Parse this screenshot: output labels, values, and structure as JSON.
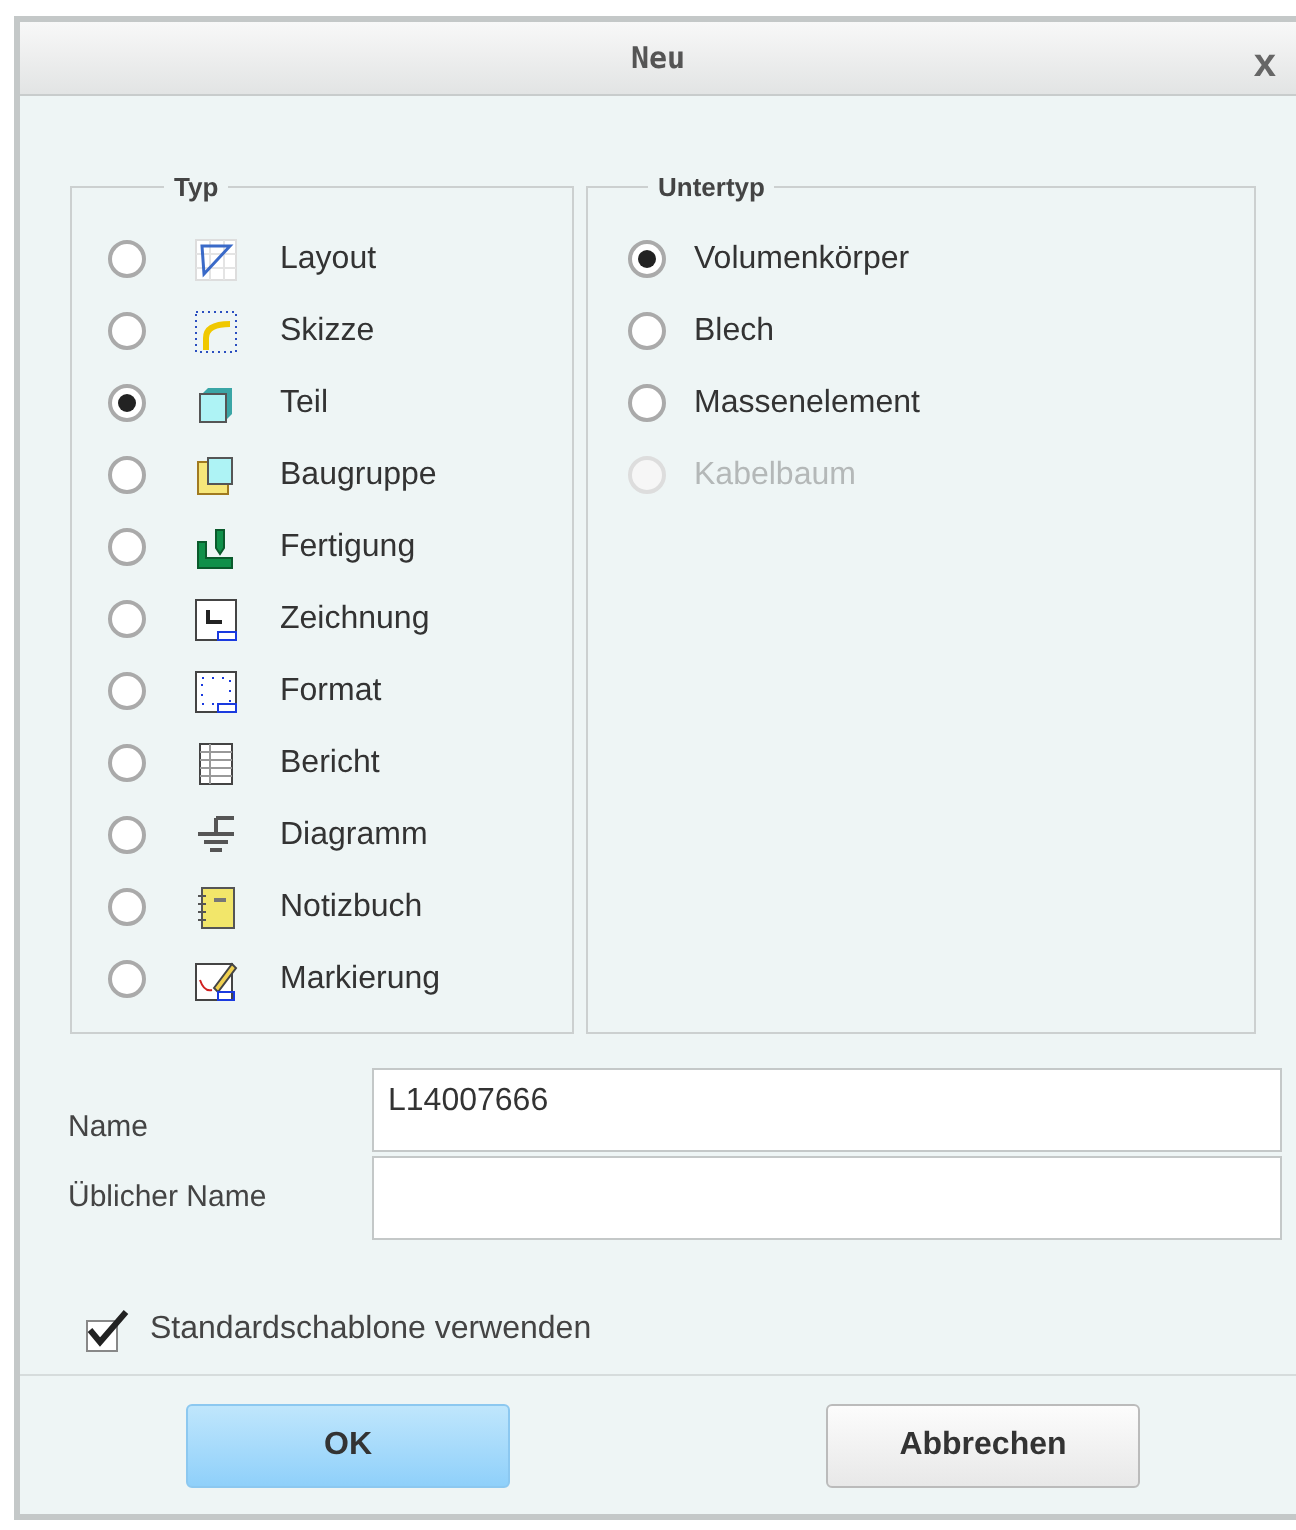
{
  "window": {
    "title": "Neu",
    "close": "x"
  },
  "typ": {
    "title": "Typ",
    "items": [
      {
        "label": "Layout",
        "kind": "layout",
        "selected": false
      },
      {
        "label": "Skizze",
        "kind": "sketch",
        "selected": false
      },
      {
        "label": "Teil",
        "kind": "part",
        "selected": true
      },
      {
        "label": "Baugruppe",
        "kind": "assembly",
        "selected": false
      },
      {
        "label": "Fertigung",
        "kind": "manufacturing",
        "selected": false
      },
      {
        "label": "Zeichnung",
        "kind": "drawing",
        "selected": false
      },
      {
        "label": "Format",
        "kind": "format",
        "selected": false
      },
      {
        "label": "Bericht",
        "kind": "report",
        "selected": false
      },
      {
        "label": "Diagramm",
        "kind": "diagram",
        "selected": false
      },
      {
        "label": "Notizbuch",
        "kind": "notebook",
        "selected": false
      },
      {
        "label": "Markierung",
        "kind": "markup",
        "selected": false
      }
    ]
  },
  "untertyp": {
    "title": "Untertyp",
    "items": [
      {
        "label": "Volumenkörper",
        "selected": true,
        "disabled": false
      },
      {
        "label": "Blech",
        "selected": false,
        "disabled": false
      },
      {
        "label": "Massenelement",
        "selected": false,
        "disabled": false
      },
      {
        "label": "Kabelbaum",
        "selected": false,
        "disabled": true
      }
    ]
  },
  "fields": [
    {
      "label": "Name",
      "value": "L14007666"
    },
    {
      "label": "Üblicher Name"
    }
  ],
  "checkbox": {
    "label": "Standardschablone verwenden",
    "checked": true
  },
  "buttons": [
    {
      "label": "OK",
      "kind": "primary"
    },
    {
      "label": "Abbrechen",
      "kind": "secondary"
    }
  ]
}
